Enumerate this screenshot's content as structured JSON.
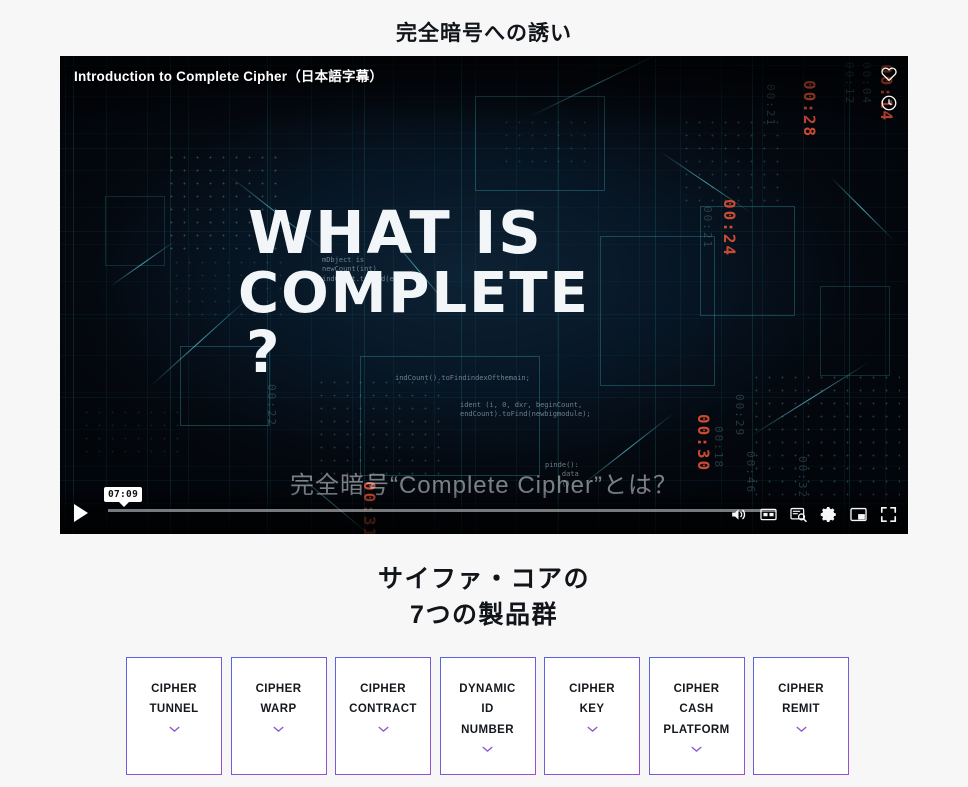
{
  "page": {
    "title": "完全暗号への誘い",
    "background_color": "#f7f7f7"
  },
  "video": {
    "title": "Introduction to Complete Cipher（日本語字幕）",
    "subtitle_text": "完全暗号“Complete Cipher”とは？",
    "time_tooltip": "07:09",
    "glitch_line1": "WHAT IS",
    "glitch_line2": "COMPLETE",
    "glitch_line3": "?",
    "code_snippet_1": "mDbject is\nnewCount(int)\nindCount.toFind(e);",
    "code_snippet_2": "indCount().toFindindexOfthemain;",
    "code_snippet_3": "ident (i, 0, dxr, beginCount,\nendCount).toFind(newbigmodule);",
    "code_snippet_4": "pinde():\n    data\n    ()",
    "overlay_numbers": [
      "00:12",
      "00:04",
      "00:14",
      "00:21",
      "00:28",
      "00:24",
      "00:21",
      "00:22",
      "00:29",
      "00:31",
      "00:30",
      "00:18",
      "00:46",
      "00:32"
    ],
    "top_right_icons": [
      {
        "name": "heart-icon",
        "label": "お気に入り"
      },
      {
        "name": "clock-icon",
        "label": "後で見る"
      }
    ],
    "controls": {
      "play_label": "再生",
      "icons": [
        {
          "name": "volume-icon",
          "label": "音量"
        },
        {
          "name": "subtitles-cc-icon",
          "label": "字幕"
        },
        {
          "name": "video-quality-icon",
          "label": "画質"
        },
        {
          "name": "gear-icon",
          "label": "設定"
        },
        {
          "name": "miniplayer-icon",
          "label": "ミニプレーヤー"
        },
        {
          "name": "fullscreen-icon",
          "label": "全画面"
        }
      ]
    }
  },
  "products_section": {
    "heading_line1": "サイファ・コアの",
    "heading_line2": "7つの製品群",
    "card_border_gradient": [
      "#5566e4",
      "#9a4fd0"
    ],
    "chevron_color": "#8b54c9",
    "cards": [
      {
        "label": "CIPHER\nTUNNEL"
      },
      {
        "label": "CIPHER\nWARP"
      },
      {
        "label": "CIPHER\nCONTRACT"
      },
      {
        "label": "DYNAMIC\nID\nNUMBER"
      },
      {
        "label": "CIPHER\nKEY"
      },
      {
        "label": "CIPHER\nCASH\nPLATFORM"
      },
      {
        "label": "CIPHER\nREMIT"
      }
    ]
  }
}
